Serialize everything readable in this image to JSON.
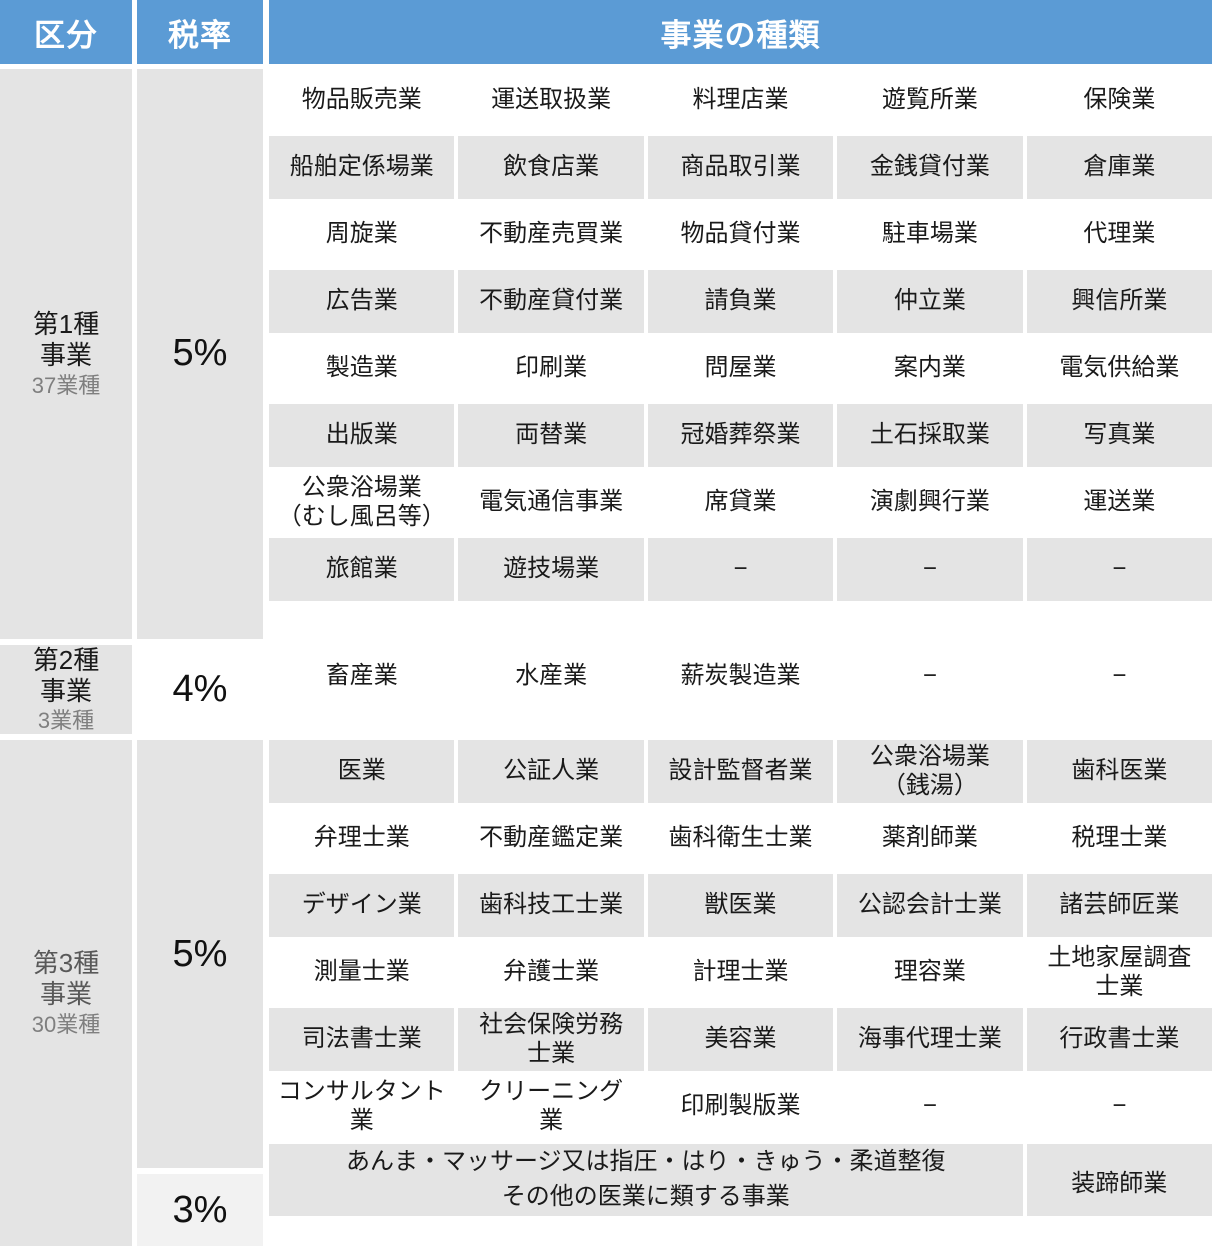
{
  "header": {
    "kubun": "区分",
    "zeiritsu": "税率",
    "gyoushu": "事業の種類",
    "accent_color": "#5B9BD5",
    "header_text_color": "#FFFFFF"
  },
  "colors": {
    "cell_gray": "#E4E4E4",
    "cell_white": "#FFFFFF",
    "cell_light": "#F2F2F2",
    "text": "#1A1A1A",
    "text_muted": "#7F7F7F"
  },
  "sections": [
    {
      "category_main": "第1種\n事業",
      "category_sub": "37業種",
      "category_muted": false,
      "rate": "5%",
      "rate_bg": "gray",
      "rows": [
        {
          "bg": "white",
          "cells": [
            "物品販売業",
            "運送取扱業",
            "料理店業",
            "遊覧所業",
            "保険業"
          ]
        },
        {
          "bg": "gray",
          "cells": [
            "船舶定係場業",
            "飲食店業",
            "商品取引業",
            "金銭貸付業",
            "倉庫業"
          ]
        },
        {
          "bg": "white",
          "cells": [
            "周旋業",
            "不動産売買業",
            "物品貸付業",
            "駐車場業",
            "代理業"
          ]
        },
        {
          "bg": "gray",
          "cells": [
            "広告業",
            "不動産貸付業",
            "請負業",
            "仲立業",
            "興信所業"
          ]
        },
        {
          "bg": "white",
          "cells": [
            "製造業",
            "印刷業",
            "問屋業",
            "案内業",
            "電気供給業"
          ]
        },
        {
          "bg": "gray",
          "cells": [
            "出版業",
            "両替業",
            "冠婚葬祭業",
            "土石採取業",
            "写真業"
          ]
        },
        {
          "bg": "white",
          "cells": [
            "公衆浴場業\n（むし風呂等）",
            "電気通信事業",
            "席貸業",
            "演劇興行業",
            "運送業"
          ]
        },
        {
          "bg": "gray",
          "cells": [
            "旅館業",
            "遊技場業",
            "−",
            "−",
            "−"
          ]
        }
      ]
    },
    {
      "category_main": "第2種\n事業",
      "category_sub": "3業種",
      "category_muted": false,
      "rate": "4%",
      "rate_bg": "white",
      "rows": [
        {
          "bg": "white",
          "cells": [
            "畜産業",
            "水産業",
            "薪炭製造業",
            "−",
            "−"
          ]
        }
      ]
    },
    {
      "category_main": "第3種\n事業",
      "category_sub": "30業種",
      "category_muted": true,
      "rate": "5%",
      "rate_bg": "gray",
      "rate2": "3%",
      "rate2_bg": "light",
      "rows": [
        {
          "bg": "gray",
          "cells": [
            "医業",
            "公証人業",
            "設計監督者業",
            "公衆浴場業\n（銭湯）",
            "歯科医業"
          ]
        },
        {
          "bg": "white",
          "cells": [
            "弁理士業",
            "不動産鑑定業",
            "歯科衛生士業",
            "薬剤師業",
            "税理士業"
          ]
        },
        {
          "bg": "gray",
          "cells": [
            "デザイン業",
            "歯科技工士業",
            "獣医業",
            "公認会計士業",
            "諸芸師匠業"
          ]
        },
        {
          "bg": "white",
          "cells": [
            "測量士業",
            "弁護士業",
            "計理士業",
            "理容業",
            "土地家屋調査\n士業"
          ]
        },
        {
          "bg": "gray",
          "cells": [
            "司法書士業",
            "社会保険労務\n士業",
            "美容業",
            "海事代理士業",
            "行政書士業"
          ]
        },
        {
          "bg": "white",
          "cells": [
            "コンサルタント\n業",
            "クリーニング\n業",
            "印刷製版業",
            "−",
            "−"
          ]
        }
      ],
      "note_row": {
        "main": "あんま・マッサージ又は指圧・はり・きゅう・柔道整復\nその他の医業に類する事業",
        "side": "装蹄師業"
      }
    }
  ]
}
